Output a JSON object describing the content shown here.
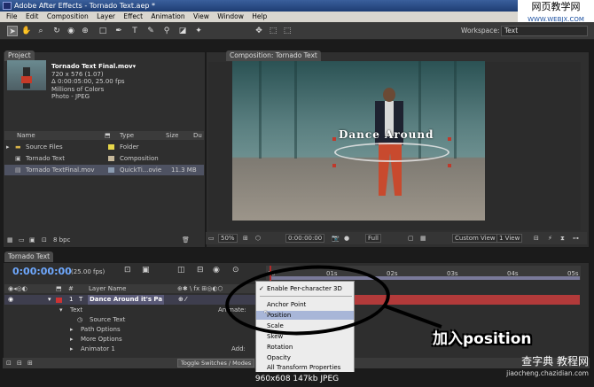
{
  "window": {
    "title": "Adobe After Effects - Tornado Text.aep *"
  },
  "watermark_top": {
    "main": "网页教学网",
    "sub": "WWW.WEBJX.COM"
  },
  "menu": [
    "File",
    "Edit",
    "Composition",
    "Layer",
    "Effect",
    "Animation",
    "View",
    "Window",
    "Help"
  ],
  "toolbar": {
    "workspace_label": "Workspace:",
    "workspace_value": "Text"
  },
  "project_panel": {
    "tab": "Project",
    "selected_name": "Tornado Text Final.mov▾",
    "info": [
      "720 x 576 (1.07)",
      "Δ 0:00:05:00, 25.00 fps",
      "Millions of Colors",
      "Photo - JPEG"
    ],
    "columns": {
      "name": "Name",
      "type": "Type",
      "size": "Size",
      "du": "Du"
    },
    "items": [
      {
        "name": "Source Files",
        "type": "Folder",
        "size": ""
      },
      {
        "name": "Tornado Text",
        "type": "Composition",
        "size": ""
      },
      {
        "name": "Tornado TextFinal.mov",
        "type": "QuickTi...ovie",
        "size": "11.3 MB"
      }
    ],
    "status": "8 bpc"
  },
  "composition_panel": {
    "tab": "Composition: Tornado Text",
    "ring_text": "Dance Around",
    "zoom": "50%",
    "timecode": "0:00:00:00",
    "resolution": "Full",
    "view": "Custom View 1",
    "views_count": "1 View"
  },
  "timeline": {
    "tab": "Tornado Text",
    "timecode": "0:00:00:00",
    "fps": "(25.00 fps)",
    "ruler_ticks": [
      "0s",
      "01s",
      "02s",
      "03s",
      "04s",
      "05s"
    ],
    "layer_name_header": "Layer Name",
    "layer": {
      "index": "1",
      "name": "Dance Around it's Pa"
    },
    "props": [
      "Text",
      "Source Text",
      "Path Options",
      "More Options",
      "Animator 1"
    ],
    "animate_label": "Animate:",
    "add_label": "Add:",
    "toggle_label": "Toggle Switches / Modes"
  },
  "context_menu": {
    "checked_item": "Enable Per-character 3D",
    "items": [
      "Anchor Point",
      "Position",
      "Scale",
      "Skew",
      "Rotation",
      "Opacity",
      "All Transform Properties"
    ],
    "highlighted": "Position"
  },
  "annotation": "加入position",
  "footer": {
    "info": "960x608  147kb  JPEG",
    "brand": "查字典 教程网",
    "url": "jiaocheng.chazidian.com"
  }
}
